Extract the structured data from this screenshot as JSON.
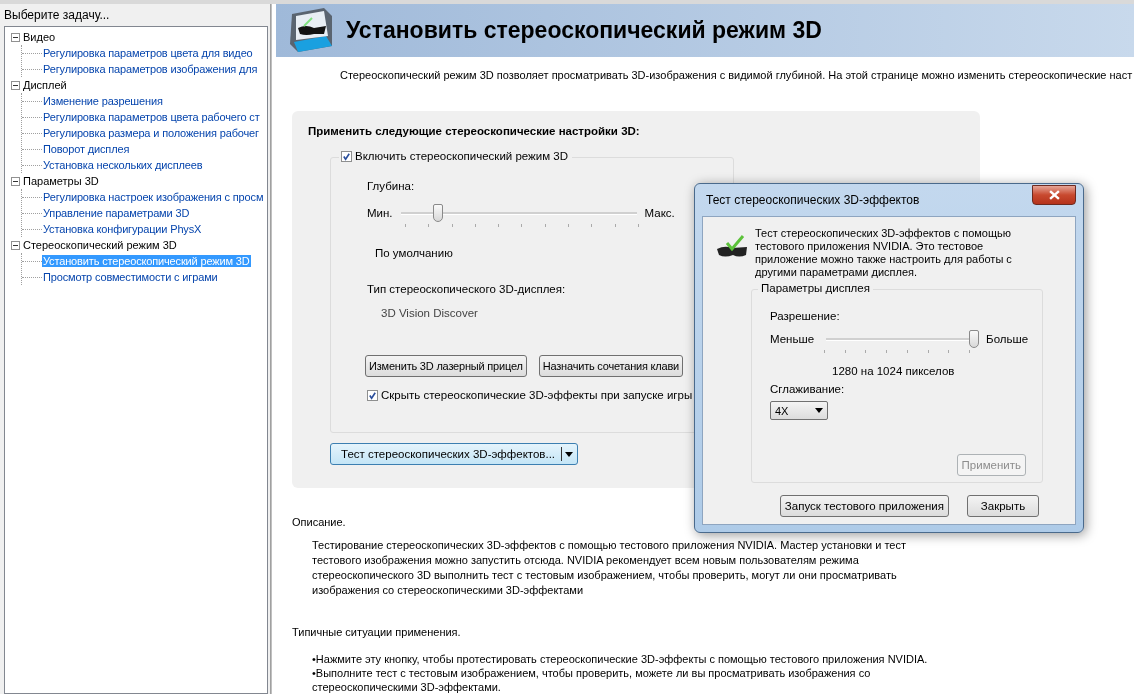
{
  "sidebar": {
    "title": "Выберите задачу...",
    "tree": [
      {
        "label": "Видео",
        "expanded": true,
        "children": [
          {
            "label": "Регулировка параметров цвета для видео",
            "selected": false
          },
          {
            "label": "Регулировка параметров изображения для",
            "selected": false
          }
        ]
      },
      {
        "label": "Дисплей",
        "expanded": true,
        "children": [
          {
            "label": "Изменение разрешения",
            "selected": false
          },
          {
            "label": "Регулировка параметров цвета рабочего ст",
            "selected": false
          },
          {
            "label": "Регулировка размера и положения рабочег",
            "selected": false
          },
          {
            "label": "Поворот дисплея",
            "selected": false
          },
          {
            "label": "Установка нескольких дисплеев",
            "selected": false
          }
        ]
      },
      {
        "label": "Параметры 3D",
        "expanded": true,
        "children": [
          {
            "label": "Регулировка настроек изображения с просм",
            "selected": false
          },
          {
            "label": "Управление параметрами 3D",
            "selected": false
          },
          {
            "label": "Установка конфигурации PhysX",
            "selected": false
          }
        ]
      },
      {
        "label": "Стереоскопический режим 3D",
        "expanded": true,
        "children": [
          {
            "label": "Установить стереоскопический режим 3D",
            "selected": true
          },
          {
            "label": "Просмотр совместимости с играми",
            "selected": false
          }
        ]
      }
    ]
  },
  "header": {
    "title": "Установить стереоскопический режим 3D"
  },
  "intro": "Стереоскопический режим 3D позволяет просматривать 3D-изображения с видимой глубиной. На этой странице можно изменить стереоскопические наст",
  "settings": {
    "heading": "Применить следующие стереоскопические настройки 3D:",
    "enable": {
      "label": "Включить стереоскопический режим 3D",
      "checked": true
    },
    "depth": {
      "label": "Глубина:",
      "min": "Мин.",
      "max": "Макс.",
      "level": 0.16,
      "default_label": "По умолчанию"
    },
    "display_type": {
      "label": "Тип стереоскопического 3D-дисплея:",
      "value": "3D Vision Discover"
    },
    "buttons": [
      "Изменить 3D лазерный прицел",
      "Назначить сочетания клави"
    ],
    "hide_effects": {
      "label": "Скрыть стереоскопические 3D-эффекты при запуске игры",
      "checked": true
    },
    "test_button": "Тест стереоскопических 3D-эффектов..."
  },
  "description": {
    "heading": "Описание.",
    "text": "Тестирование стереоскопических 3D-эффектов с помощью тестового приложения NVIDIA. Мастер установки и тест тестового изображения можно запустить отсюда. NVIDIA рекомендует всем новым пользователям режима стереоскопического 3D выполнить тест с тестовым изображением, чтобы проверить, могут ли они просматривать изображения со стереоскопическими 3D-эффектами"
  },
  "usage": {
    "heading": "Типичные ситуации применения.",
    "bullets": [
      "•Нажмите эту кнопку, чтобы протестировать стереоскопические 3D-эффекты с помощью тестового приложения NVIDIA.",
      "•Выполните тест с тестовым изображением, чтобы проверить, можете ли вы просматривать изображения со стереоскопическими 3D-эффектами."
    ]
  },
  "dialog": {
    "title": "Тест стереоскопических 3D-эффектов",
    "text": "Тест стереоскопических 3D-эффектов с помощью тестового приложения NVIDIA. Это тестовое приложение можно также настроить для работы с другими параметрами дисплея.",
    "group_title": "Параметры дисплея",
    "resolution": {
      "label": "Разрешение:",
      "min": "Меньше",
      "max": "Больше",
      "level": 1,
      "reading": "1280 на 1024 пикселов"
    },
    "antialiasing": {
      "label": "Сглаживание:",
      "value": "4X"
    },
    "apply_button": {
      "label": "Применить",
      "disabled": true
    },
    "buttons": [
      "Запуск тестового приложения",
      "Закрыть"
    ]
  }
}
